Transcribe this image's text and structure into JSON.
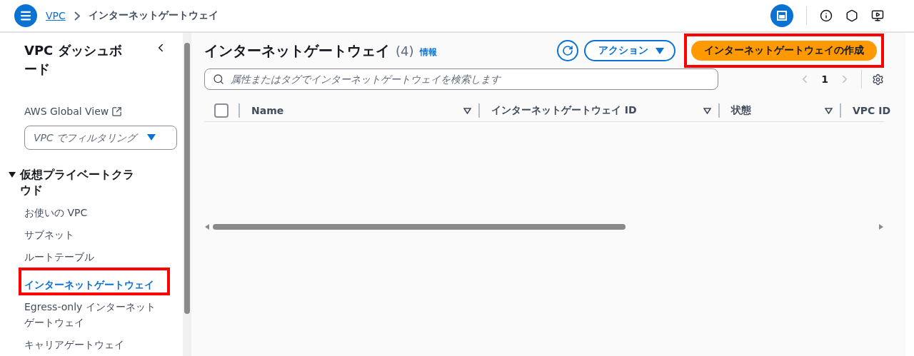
{
  "breadcrumb": {
    "items": [
      "VPC",
      "インターネットゲートウェイ"
    ]
  },
  "sidebar": {
    "title": "VPC ダッシュボード",
    "global_view": "AWS Global View",
    "filter": {
      "placeholder": "VPC でフィルタリング"
    },
    "section": {
      "label": "仮想プライベートクラウド",
      "expanded": true,
      "items": [
        {
          "label": "お使いの VPC",
          "selected": false,
          "highlighted": false
        },
        {
          "label": "サブネット",
          "selected": false,
          "highlighted": false
        },
        {
          "label": "ルートテーブル",
          "selected": false,
          "highlighted": false
        },
        {
          "label": "インターネットゲートウェイ",
          "selected": true,
          "highlighted": true
        },
        {
          "label": "Egress-only インターネットゲートウェイ",
          "selected": false,
          "highlighted": false
        },
        {
          "label": "キャリアゲートウェイ",
          "selected": false,
          "highlighted": false
        }
      ]
    }
  },
  "main": {
    "title": "インターネットゲートウェイ",
    "count": "(4)",
    "info": "情報",
    "actions": "アクション",
    "create": {
      "label": "インターネットゲートウェイの作成",
      "highlighted": true
    },
    "search": {
      "placeholder": "属性またはタグでインターネットゲートウェイを検索します"
    },
    "page": "1",
    "table": {
      "columns": [
        "Name",
        "インターネットゲートウェイ ID",
        "状態",
        "VPC ID"
      ],
      "all_checked": false
    }
  }
}
